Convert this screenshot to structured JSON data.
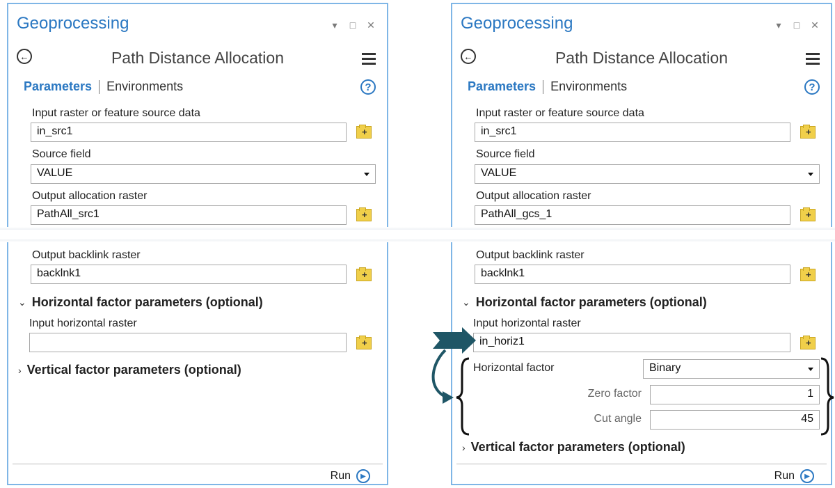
{
  "left": {
    "pane_title": "Geoprocessing",
    "tool_title": "Path Distance Allocation",
    "tabs": {
      "parameters": "Parameters",
      "environments": "Environments"
    },
    "help_label": "?",
    "fields": {
      "input_src_label": "Input raster or feature source data",
      "input_src_value": "in_src1",
      "source_field_label": "Source field",
      "source_field_value": "VALUE",
      "output_alloc_label": "Output allocation raster",
      "output_alloc_value": "PathAll_src1",
      "backlink_label": "Output backlink raster",
      "backlink_value": "backlnk1",
      "horiz_section": "Horizontal factor parameters (optional)",
      "input_horiz_label": "Input horizontal raster",
      "input_horiz_value": "",
      "vert_section": "Vertical factor parameters (optional)"
    },
    "run_label": "Run"
  },
  "right": {
    "pane_title": "Geoprocessing",
    "tool_title": "Path Distance Allocation",
    "tabs": {
      "parameters": "Parameters",
      "environments": "Environments"
    },
    "help_label": "?",
    "fields": {
      "input_src_label": "Input raster or feature source data",
      "input_src_value": "in_src1",
      "source_field_label": "Source field",
      "source_field_value": "VALUE",
      "output_alloc_label": "Output allocation raster",
      "output_alloc_value": "PathAll_gcs_1",
      "backlink_label": "Output backlink raster",
      "backlink_value": "backlnk1",
      "horiz_section": "Horizontal factor parameters (optional)",
      "input_horiz_label": "Input horizontal raster",
      "input_horiz_value": "in_horiz1",
      "horiz_factor_label": "Horizontal factor",
      "horiz_factor_value": "Binary",
      "zero_factor_label": "Zero factor",
      "zero_factor_value": "1",
      "cut_angle_label": "Cut angle",
      "cut_angle_value": "45",
      "vert_section": "Vertical factor parameters (optional)"
    },
    "run_label": "Run"
  },
  "window_controls": {
    "dropdown": "▾",
    "maximize": "□",
    "close": "✕"
  },
  "colors": {
    "accent": "#2b78c2",
    "panel_border": "#7fb6e6",
    "annotation": "#1f5666"
  }
}
